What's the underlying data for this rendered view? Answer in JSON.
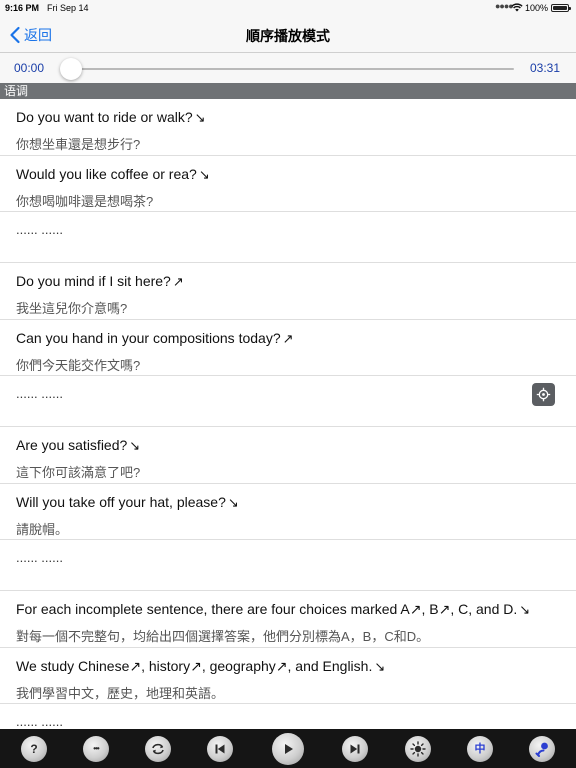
{
  "status": {
    "time": "9:16 PM",
    "date": "Fri Sep 14",
    "battery": "100%"
  },
  "nav": {
    "back_label": "返回",
    "title": "順序播放模式"
  },
  "player": {
    "current_time": "00:00",
    "total_time": "03:31",
    "progress": 0
  },
  "section": {
    "title": "语调"
  },
  "items": [
    {
      "en": "Do you want to ride or walk?",
      "mark": "↘",
      "zh": "你想坐車還是想步行?"
    },
    {
      "en": "Would you like coffee or rea?",
      "mark": "↘",
      "zh": "你想喝咖啡還是想喝茶?"
    },
    {
      "placeholder": "...... ......"
    },
    {
      "en": "Do you mind if I sit here?",
      "mark": "↗",
      "zh": "我坐這兒你介意嗎?"
    },
    {
      "en": "Can you hand in your compositions today?",
      "mark": "↗",
      "zh": "你們今天能交作文嗎?"
    },
    {
      "placeholder": "...... ......"
    },
    {
      "en": "Are you satisfied?",
      "mark": "↘",
      "zh": "這下你可該滿意了吧?"
    },
    {
      "en": "Will you take off your hat, please?",
      "mark": "↘",
      "zh": "請脫帽。"
    },
    {
      "placeholder": "...... ......"
    },
    {
      "en": "For each incomplete sentence, there are four choices marked A↗, B↗, C, and D.",
      "mark": "↘",
      "zh": "對每一個不完整句，均給出四個選擇答案，他們分別標為A，B，C和D。"
    },
    {
      "en": "We study Chinese↗, history↗, geography↗, and English.",
      "mark": "↘",
      "zh": "我們學習中文，歷史，地理和英語。"
    },
    {
      "placeholder": "...... ......"
    }
  ],
  "toolbar": {
    "help_glyph": "?",
    "more_glyph": "•••",
    "lang_glyph": "中"
  },
  "icons": {
    "back": "chevron-left-icon",
    "locate": "crosshair-icon",
    "toolbar": [
      "help-icon",
      "more-icon",
      "repeat-icon",
      "previous-icon",
      "play-icon",
      "next-icon",
      "brightness-icon",
      "language-icon",
      "speaker-icon"
    ]
  },
  "colors": {
    "accent": "#1a73e8",
    "time_text": "#1a3ea8",
    "section_bg": "#6f7275",
    "toolbar_bg": "#151515"
  }
}
